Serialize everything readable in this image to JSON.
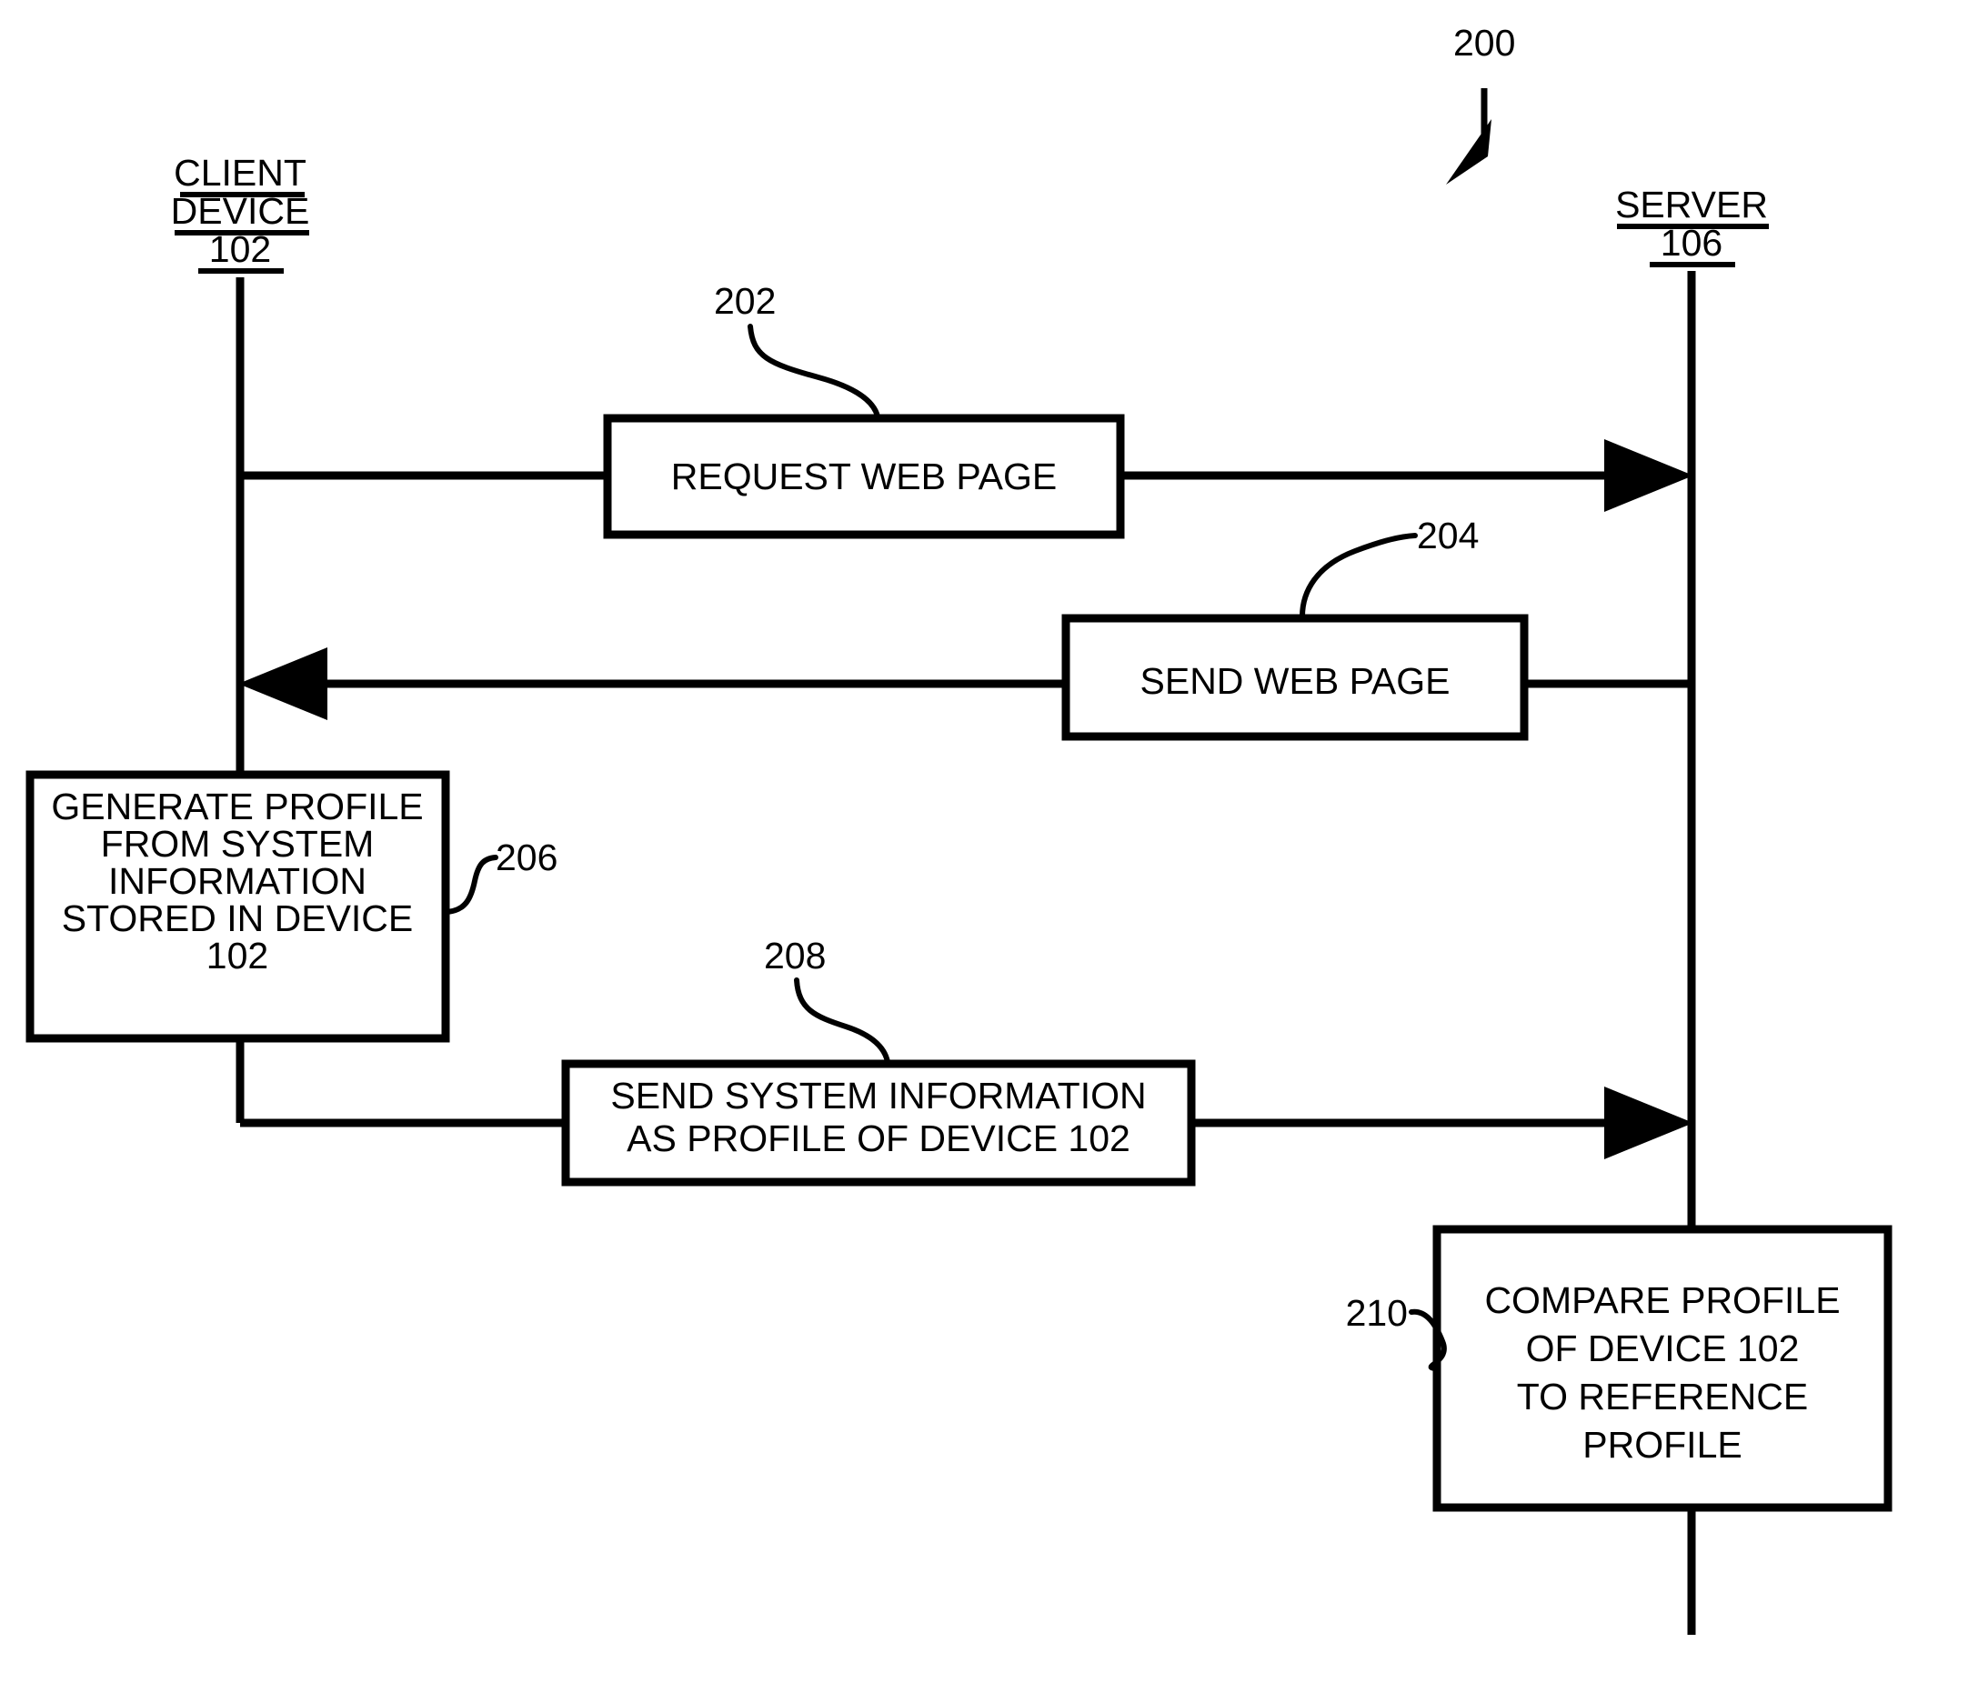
{
  "figure": {
    "number": "200",
    "type": "sequence-diagram",
    "background_color": "#ffffff",
    "line_color": "#000000"
  },
  "lanes": [
    {
      "id": "client",
      "name_lines": [
        "CLIENT",
        "DEVICE"
      ],
      "name_line_1": "CLIENT",
      "name_line_2": "DEVICE",
      "ref": "102"
    },
    {
      "id": "server",
      "name_lines": [
        "SERVER"
      ],
      "name_line_1": "SERVER",
      "ref": "106"
    }
  ],
  "steps": [
    {
      "ref": "202",
      "label_lines": [
        "REQUEST WEB PAGE"
      ],
      "line_1": "REQUEST WEB PAGE",
      "direction": "client-to-server",
      "owner": "message"
    },
    {
      "ref": "204",
      "label_lines": [
        "SEND WEB PAGE"
      ],
      "line_1": "SEND WEB PAGE",
      "direction": "server-to-client",
      "owner": "message"
    },
    {
      "ref": "206",
      "label_lines": [
        "GENERATE PROFILE",
        "FROM SYSTEM",
        "INFORMATION",
        "STORED IN DEVICE",
        "102"
      ],
      "line_1": "GENERATE PROFILE",
      "line_2": "FROM SYSTEM",
      "line_3": "INFORMATION",
      "line_4": "STORED IN DEVICE",
      "line_5": "102",
      "direction": "none",
      "owner": "client"
    },
    {
      "ref": "208",
      "label_lines": [
        "SEND SYSTEM INFORMATION",
        "AS PROFILE OF DEVICE 102"
      ],
      "line_1": "SEND SYSTEM INFORMATION",
      "line_2": "AS PROFILE OF DEVICE 102",
      "direction": "client-to-server",
      "owner": "message"
    },
    {
      "ref": "210",
      "label_lines": [
        "COMPARE PROFILE",
        "OF DEVICE 102",
        "TO REFERENCE",
        "PROFILE"
      ],
      "line_1": "COMPARE PROFILE",
      "line_2": "OF DEVICE 102",
      "line_3": "TO REFERENCE",
      "line_4": "PROFILE",
      "direction": "none",
      "owner": "server"
    }
  ]
}
